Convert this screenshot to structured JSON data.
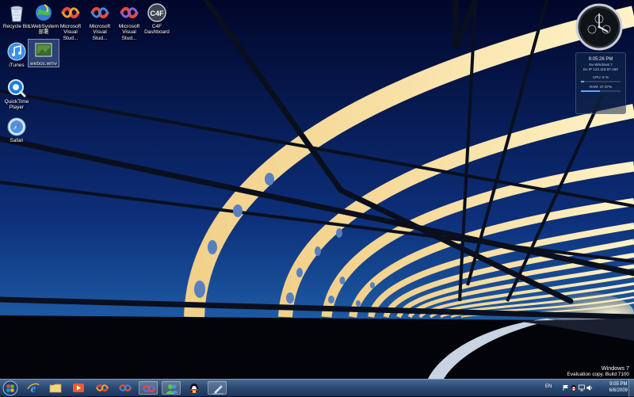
{
  "desktop_icons": [
    {
      "name": "recycle-bin-icon",
      "label": "Recycle Bin"
    },
    {
      "name": "lwebsystem-icon",
      "label": "LWebSystem 部署"
    },
    {
      "name": "visual-studio-icon",
      "label": "Microsoft Visual Stud..."
    },
    {
      "name": "visual-studio-icon",
      "label": "Microsoft Visual Stud..."
    },
    {
      "name": "visual-studio-icon",
      "label": "Microsoft Visual Stud..."
    },
    {
      "name": "c4f-dashboard-icon",
      "label": "C4F Dashboard"
    },
    {
      "name": "itunes-icon",
      "label": "iTunes"
    },
    {
      "name": "video-file-icon",
      "label": "webos.wmv"
    },
    {
      "name": "quicktime-icon",
      "label": "QuickTime Player"
    },
    {
      "name": "safari-icon",
      "label": "Safari"
    }
  ],
  "gadget": {
    "time": "9:05:26 PM",
    "line1": "Nv-Windows 7",
    "line2": "Ex IP 122.118.97.160",
    "cpu_label": "CPU: 8 %",
    "cpu_level": 0.08,
    "ram_label": "RAM: 47.37%",
    "ram_level": 0.4737
  },
  "watermark": {
    "os": "Windows 7",
    "build": "Evaluation copy. Build 7100"
  },
  "taskbar": {
    "language": "EN",
    "time": "9:05 PM",
    "date": "6/8/2009"
  },
  "colors": {
    "sky_top": "#01062a",
    "sky_bottom": "#1e5da6",
    "structure": "#e8c47a",
    "taskbar": "#2c4a72"
  }
}
